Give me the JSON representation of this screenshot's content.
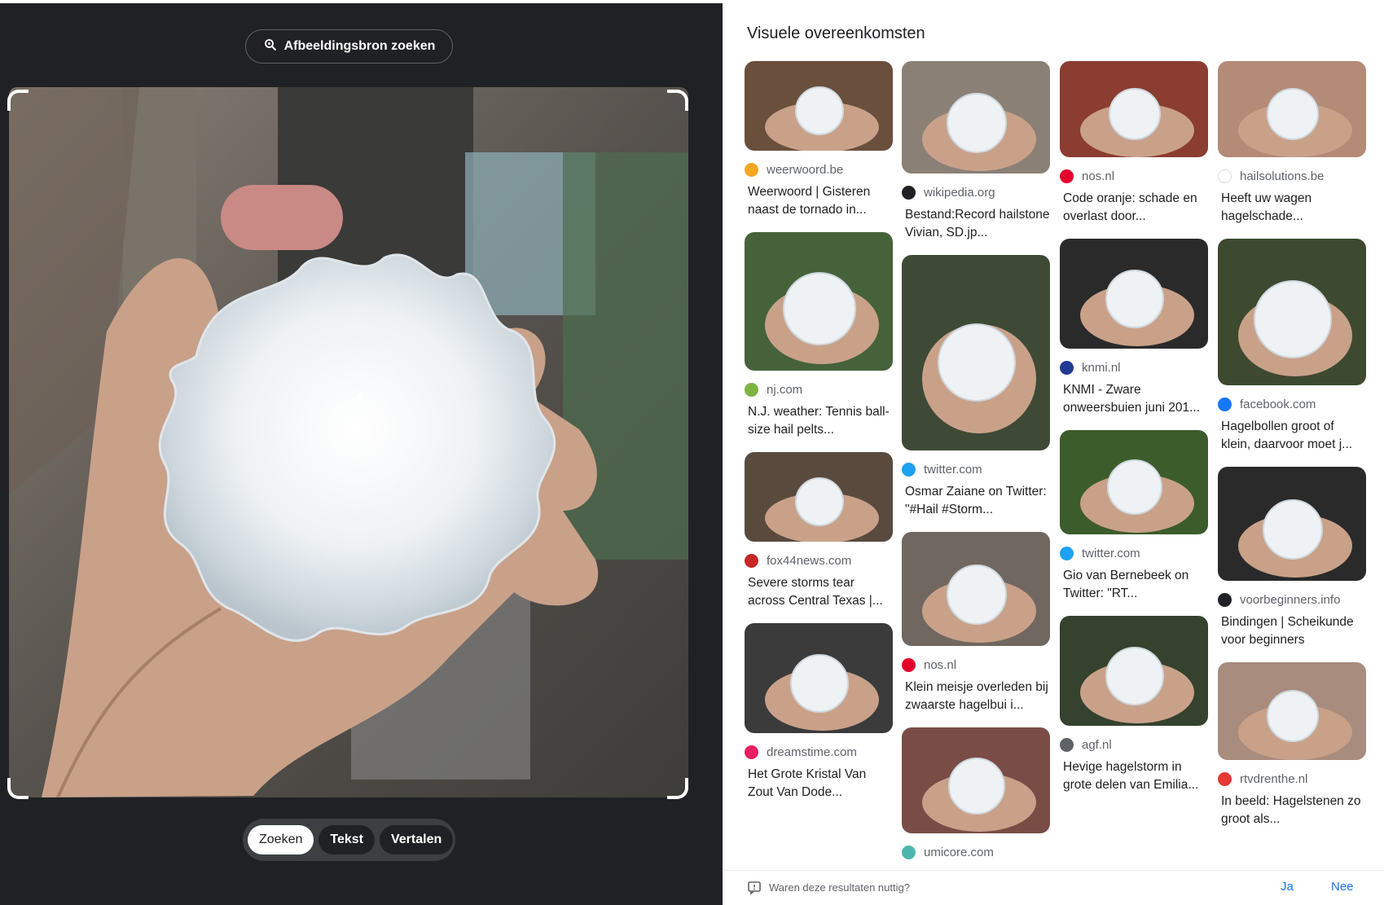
{
  "left_panel": {
    "find_source_label": "Afbeeldingsbron zoeken",
    "modes": [
      "Zoeken",
      "Tekst",
      "Vertalen"
    ],
    "active_mode": "Zoeken"
  },
  "right_panel": {
    "title": "Visuele overeenkomsten",
    "columns": [
      [
        {
          "source": "weerwoord.be",
          "title": "Weerwoord | Gisteren naast de tornado in...",
          "favicon_color": "#f5a623",
          "favicon": "sun-icon"
        },
        {
          "source": "nj.com",
          "title": "N.J. weather: Tennis ball-size hail pelts...",
          "favicon_color": "#7cb342",
          "favicon": "nj-icon"
        },
        {
          "source": "fox44news.com",
          "title": "Severe storms tear across Central Texas |...",
          "favicon_color": "#c62828",
          "favicon": "fox44-icon"
        },
        {
          "source": "dreamstime.com",
          "title": "Het Grote Kristal Van Zout Van Dode...",
          "favicon_color": "#e91e63",
          "favicon": "dreamstime-icon"
        }
      ],
      [
        {
          "source": "wikipedia.org",
          "title": "Bestand:Record hailstone Vivian, SD.jp...",
          "favicon_color": "#202124",
          "favicon": "wikipedia-icon"
        },
        {
          "source": "twitter.com",
          "title": "Osmar Zaiane on Twitter: \"#Hail #Storm...",
          "favicon_color": "#1da1f2",
          "favicon": "twitter-icon"
        },
        {
          "source": "nos.nl",
          "title": "Klein meisje overleden bij zwaarste hagelbui i...",
          "favicon_color": "#e4002b",
          "favicon": "nos-icon"
        },
        {
          "source": "umicore.com",
          "title": "",
          "favicon_color": "#4db6ac",
          "favicon": "umicore-icon"
        }
      ],
      [
        {
          "source": "nos.nl",
          "title": "Code oranje: schade en overlast door...",
          "favicon_color": "#e4002b",
          "favicon": "nos-icon"
        },
        {
          "source": "knmi.nl",
          "title": "KNMI - Zware onweersbuien juni 201...",
          "favicon_color": "#1f3a93",
          "favicon": "knmi-icon"
        },
        {
          "source": "twitter.com",
          "title": "Gio van Bernebeek on Twitter: \"RT...",
          "favicon_color": "#1da1f2",
          "favicon": "twitter-icon"
        },
        {
          "source": "agf.nl",
          "title": "Hevige hagelstorm in grote delen van Emilia...",
          "favicon_color": "#5f6368",
          "favicon": "globe-icon"
        }
      ],
      [
        {
          "source": "hailsolutions.be",
          "title": "Heeft uw wagen hagelschade...",
          "favicon_color": "#ffffff",
          "favicon": "hailsolutions-icon"
        },
        {
          "source": "facebook.com",
          "title": "Hagelbollen groot of klein, daarvoor moet j...",
          "favicon_color": "#1877f2",
          "favicon": "facebook-icon"
        },
        {
          "source": "voorbeginners.info",
          "title": "Bindingen | Scheikunde voor beginners",
          "favicon_color": "#202124",
          "favicon": "voorbeginners-icon"
        },
        {
          "source": "rtvdrenthe.nl",
          "title": "In beeld: Hagelstenen zo groot als...",
          "favicon_color": "#e53935",
          "favicon": "rtv-icon"
        }
      ]
    ]
  },
  "feedback": {
    "question": "Waren deze resultaten nuttig?",
    "yes": "Ja",
    "no": "Nee"
  },
  "colors": {
    "dark_bg": "#202124",
    "accent": "#1a73e8"
  }
}
